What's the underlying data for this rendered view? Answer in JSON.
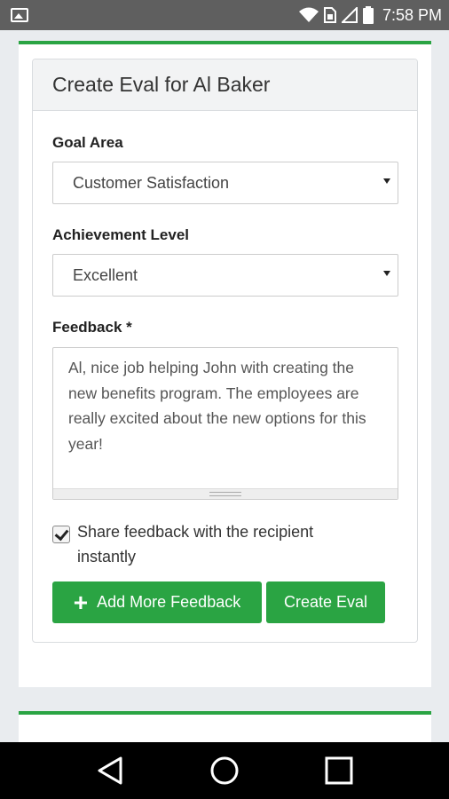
{
  "status_bar": {
    "time": "7:58 PM"
  },
  "panel": {
    "title": "Create Eval for Al Baker"
  },
  "goal_area": {
    "label": "Goal Area",
    "selected": "Customer Satisfaction"
  },
  "achievement_level": {
    "label": "Achievement Level",
    "selected": "Excellent"
  },
  "feedback": {
    "label": "Feedback *",
    "value": "Al, nice job helping John with creating the new benefits program. The employees are really excited about the new options for this year!"
  },
  "share": {
    "checked": true,
    "label": "Share feedback with the recipient instantly"
  },
  "buttons": {
    "add_more": "Add More Feedback",
    "create": "Create Eval"
  },
  "colors": {
    "accent": "#2aa443",
    "status_bar": "#5f5f5f",
    "nav_bar": "#000000"
  }
}
